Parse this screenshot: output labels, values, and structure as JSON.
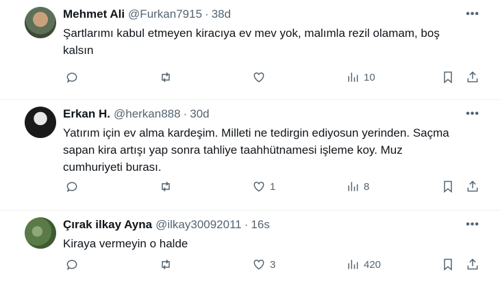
{
  "tweets": [
    {
      "name": "Mehmet Ali",
      "handle": "@Furkan7915",
      "separator": "·",
      "time": "38d",
      "text": "Şartlarımı kabul etmeyen kiracıya ev mev yok, malımla rezil olamam, boş kalsın",
      "likes": "",
      "views": "10"
    },
    {
      "name": "Erkan H.",
      "handle": "@herkan888",
      "separator": "·",
      "time": "30d",
      "text": "Yatırım için ev alma kardeşim. Milleti ne tedirgin ediyosun yerinden. Saçma sapan kira artışı yap sonra tahliye taahhütnamesi işleme koy. Muz cumhuriyeti burası.",
      "likes": "1",
      "views": "8"
    },
    {
      "name": "Çırak ilkay Ayna",
      "handle": "@ilkay30092011",
      "separator": "·",
      "time": "16s",
      "text": "Kiraya vermeyin o halde",
      "likes": "3",
      "views": "420"
    }
  ],
  "more_label": "•••"
}
